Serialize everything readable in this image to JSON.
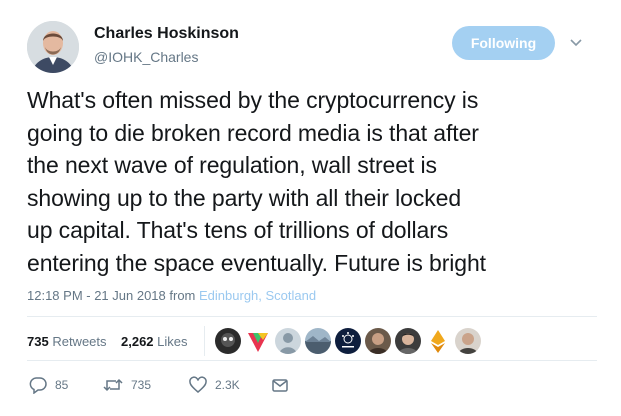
{
  "author": {
    "name": "Charles Hoskinson",
    "handle": "@IOHK_Charles",
    "follow_label": "Following"
  },
  "tweet": {
    "lines": [
      "What's often missed by the cryptocurrency is",
      "going to die broken record media is that after",
      "the next wave of regulation, wall street is",
      "showing up to the party with all their locked",
      "up capital. That's tens of trillions of dollars",
      "entering the space eventually. Future is bright"
    ],
    "time": "12:18 PM - 21 Jun 2018",
    "from_label": "from",
    "location": "Edinburgh, Scotland"
  },
  "stats": {
    "retweets_count": "735",
    "retweets_label": "Retweets",
    "likes_count": "2,262",
    "likes_label": "Likes"
  },
  "likers": [
    {
      "icon": "liker-avatar-dark"
    },
    {
      "icon": "liker-avatar-colorful"
    },
    {
      "icon": "liker-avatar-default"
    },
    {
      "icon": "liker-avatar-landscape"
    },
    {
      "icon": "liker-avatar-cardano"
    },
    {
      "icon": "liker-avatar-person"
    },
    {
      "icon": "liker-avatar-person"
    },
    {
      "icon": "liker-avatar-ethereum"
    },
    {
      "icon": "liker-avatar-person"
    }
  ],
  "actions": {
    "replies": "85",
    "retweets": "735",
    "likes": "2.3K"
  },
  "colors": {
    "follow_bg": "#a4d0f2",
    "link": "#9bc9f0",
    "muted": "#657786"
  }
}
